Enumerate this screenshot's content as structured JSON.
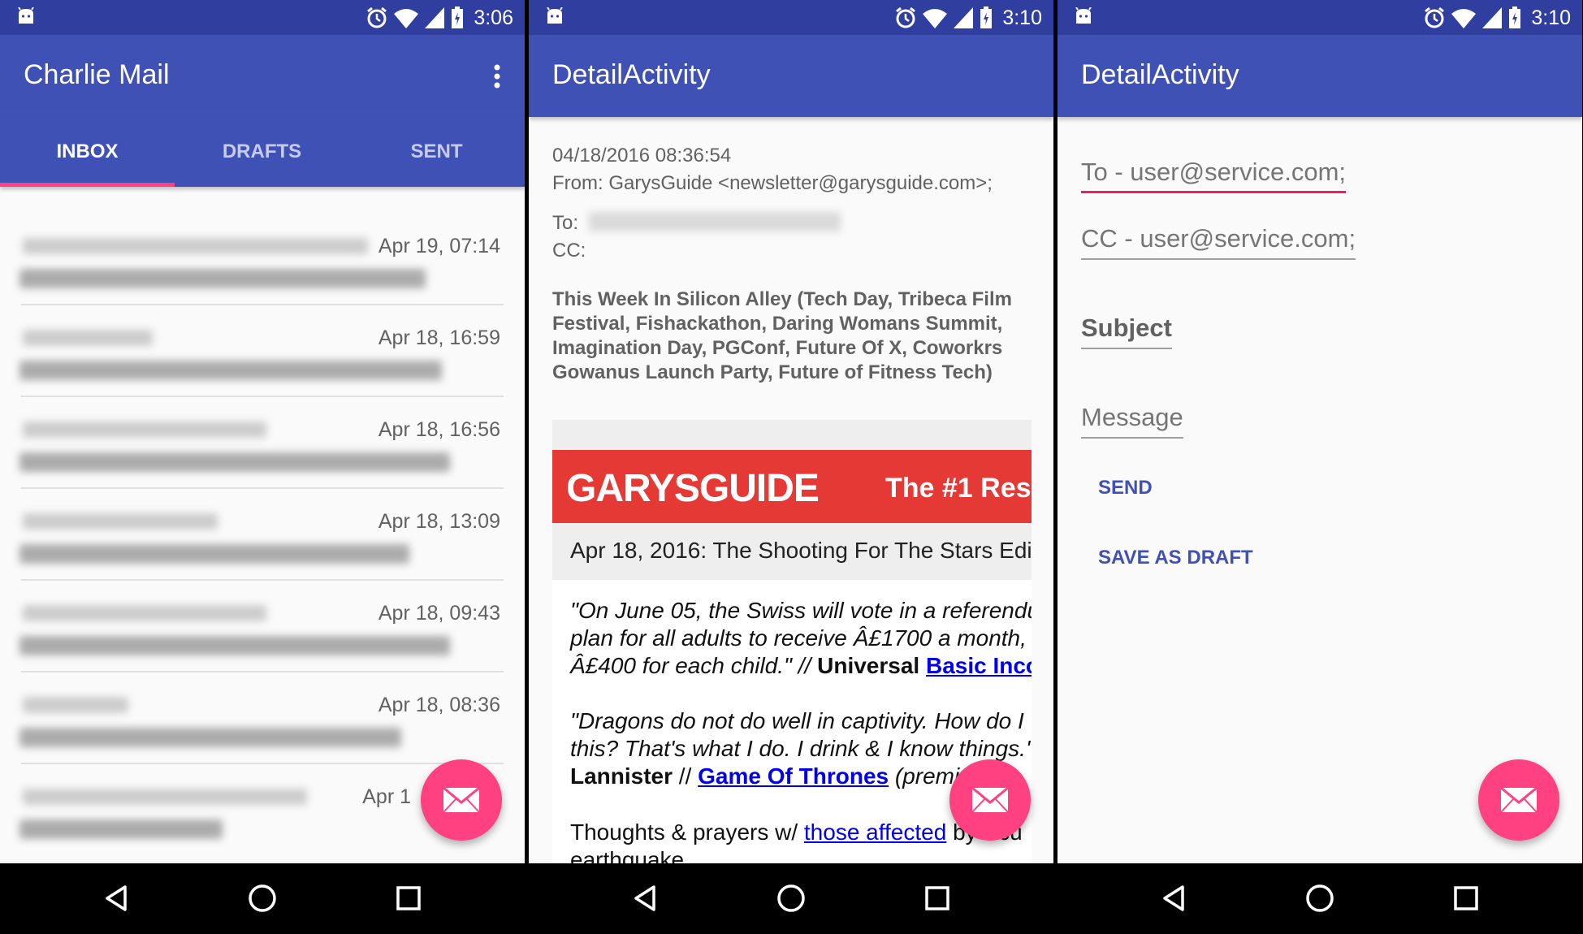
{
  "status_bars": [
    {
      "time": "3:06"
    },
    {
      "time": "3:10"
    },
    {
      "time": "3:10"
    }
  ],
  "inbox": {
    "title": "Charlie Mail",
    "tabs": [
      {
        "label": "INBOX",
        "active": true
      },
      {
        "label": "DRAFTS",
        "active": false
      },
      {
        "label": "SENT",
        "active": false
      }
    ],
    "items": [
      {
        "date": "Apr 19, 07:14"
      },
      {
        "date": "Apr 18, 16:59"
      },
      {
        "date": "Apr 18, 16:56"
      },
      {
        "date": "Apr 18, 13:09"
      },
      {
        "date": "Apr 18, 09:43"
      },
      {
        "date": "Apr 18, 08:36"
      },
      {
        "date": "Apr 1"
      }
    ]
  },
  "detail": {
    "title": "DetailActivity",
    "date": "04/18/2016 08:36:54",
    "from": "From: GarysGuide <newsletter@garysguide.com>;",
    "to_label": "To:",
    "cc_label": "CC:",
    "subject": "This Week In Silicon Alley (Tech Day, Tribeca Film Festival, Fishackathon, Daring Womans Summit, Imagination Day, PGConf, Future Of X, Coworkrs Gowanus Launch Party, Future of Fitness Tech)",
    "body": {
      "brand": "GARYSGUIDE",
      "tagline": "The #1 Res",
      "headline": "Apr 18, 2016: The Shooting For The Stars Edi",
      "quote1_line1": "\"On June 05, the Swiss will vote in a referendu",
      "quote1_line2": "plan for all adults to receive Â£1700 a month,",
      "quote1_line3a": "Â£400 for each child.\" // ",
      "quote1_line3b": "Universal",
      "quote1_link": "Basic Inco",
      "quote2_line1": "\"Dragons do not do well in captivity. How do I",
      "quote2_line2": "this? That's what I do. I drink & I know things.'",
      "quote2_line3a": "Lannister",
      "quote2_line3b": " // ",
      "quote2_link": "Game Of Thrones",
      "quote2_line3c": " (premi",
      "para3_a": "Thoughts & prayers w/ ",
      "para3_link": "those affected",
      "para3_b": " by Ecu",
      "para3_line2": "earthquake"
    }
  },
  "compose": {
    "title": "DetailActivity",
    "to_value": "To - user@service.com;",
    "cc_value": "CC - user@service.com;",
    "subject_value": "Subject",
    "message_placeholder": "Message",
    "send_label": "SEND",
    "draft_label": "SAVE AS DRAFT"
  },
  "colors": {
    "primary": "#3f51b5",
    "primary_dark": "#303f9f",
    "accent": "#ff4081"
  },
  "icons": [
    "android-icon",
    "alarm-icon",
    "wifi-icon",
    "signal-icon",
    "battery-icon",
    "overflow-menu-icon",
    "email-icon",
    "back-icon",
    "home-icon",
    "recents-icon"
  ]
}
